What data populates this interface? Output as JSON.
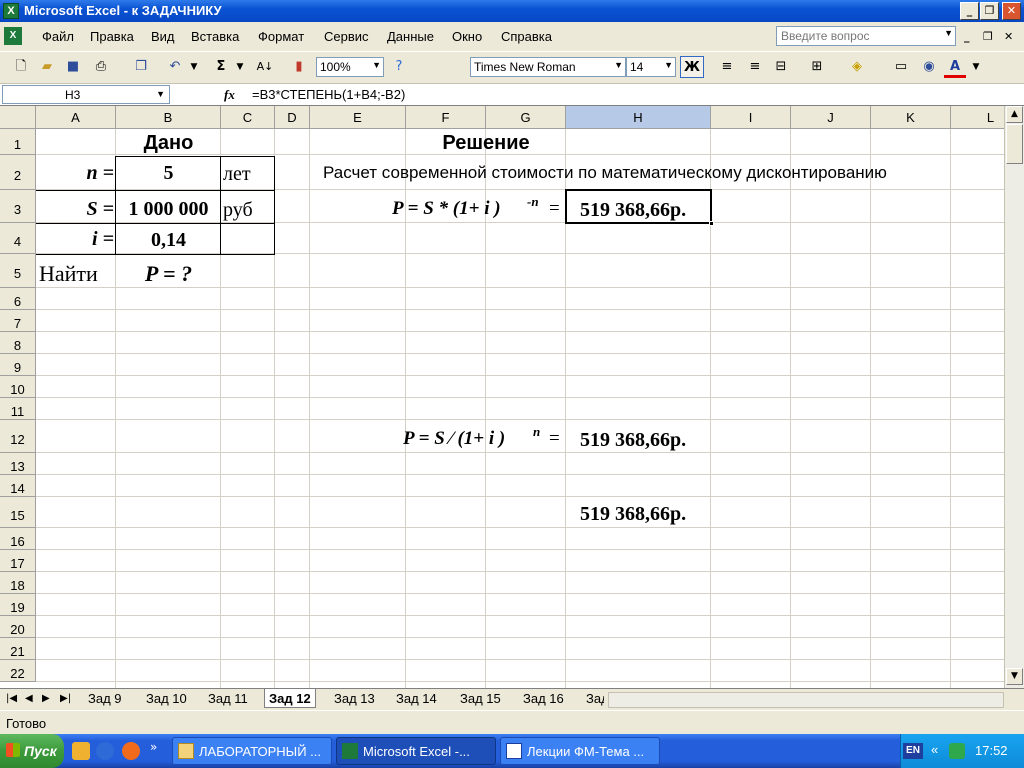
{
  "window": {
    "title": "Microsoft Excel - к ЗАДАЧНИКУ",
    "app_icon": "excel-icon",
    "controls": [
      "_",
      "❐",
      "✕"
    ]
  },
  "menu": {
    "items": [
      "Файл",
      "Правка",
      "Вид",
      "Вставка",
      "Формат",
      "Сервис",
      "Данные",
      "Окно",
      "Справка"
    ],
    "help_placeholder": "Введите вопрос",
    "doc_controls": [
      "_",
      "❐",
      "✕"
    ]
  },
  "toolbar": {
    "zoom": "100%",
    "font_name": "Times New Roman",
    "font_size": "14",
    "bold_label": "Ж",
    "sigma": "Σ",
    "font_color_letter": "А"
  },
  "formula_bar": {
    "name_box": "H3",
    "fx": "fx",
    "formula": "=B3*СТЕПЕНЬ(1+B4;-B2)"
  },
  "columns": [
    "A",
    "B",
    "C",
    "D",
    "E",
    "F",
    "G",
    "H",
    "I",
    "J",
    "K",
    "L"
  ],
  "rows": [
    "1",
    "2",
    "3",
    "4",
    "5",
    "6",
    "7",
    "8",
    "9",
    "10",
    "11",
    "12",
    "13",
    "14",
    "15",
    "16",
    "17",
    "18",
    "19",
    "20",
    "21",
    "22"
  ],
  "sheet": {
    "given_header": "Дано",
    "n_label": "n =",
    "n_value": "5",
    "n_unit": "лет",
    "s_label": "S =",
    "s_value": "1 000 000",
    "s_unit": "руб",
    "i_label": "i =",
    "i_value": "0,14",
    "find_label": "Найти",
    "find_target": "P = ?",
    "solution_header": "Решение",
    "solution_subtitle": "Расчет современной стоимости по математическому дисконтированию",
    "formula1_main": "P = S * (1+ i )",
    "formula1_exp": "-n",
    "formula1_eq": "=",
    "result1": "519 368,66р.",
    "formula2_main": "P = S ⁄ (1+ i )",
    "formula2_exp": "n",
    "formula2_eq": "=",
    "result2": "519 368,66р.",
    "result3": "519 368,66р."
  },
  "sheet_tabs": {
    "tabs": [
      "Зад 9",
      "Зад 10",
      "Зад 11",
      "Зад 12",
      "Зад 13",
      "Зад 14",
      "Зад 15",
      "Зад 16",
      "Зад"
    ],
    "active": "Зад 12"
  },
  "status": {
    "text": "Готово"
  },
  "taskbar": {
    "start_label": "Пуск",
    "tasks": [
      "ЛАБОРАТОРНЫЙ ...",
      "Microsoft Excel -...",
      "Лекции ФМ-Тема ..."
    ],
    "lang": "EN",
    "clock": "17:52",
    "tray_chevron": "«"
  }
}
